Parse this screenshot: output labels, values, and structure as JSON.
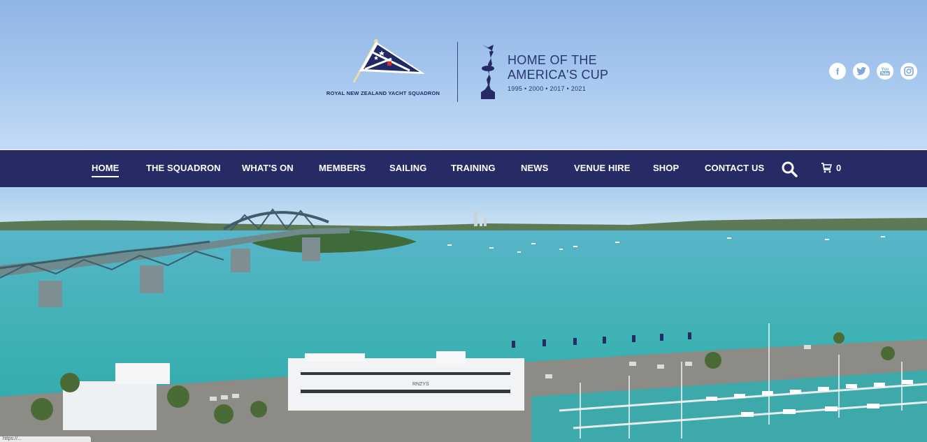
{
  "club": {
    "name": "ROYAL NEW ZEALAND YACHT SQUADRON",
    "tagline_line1": "HOME OF THE",
    "tagline_line2": "AMERICA'S CUP",
    "tagline_years": "1995 • 2000 • 2017 • 2021"
  },
  "social": [
    {
      "icon": "facebook-icon",
      "glyph": "f"
    },
    {
      "icon": "twitter-icon",
      "glyph": "🐦"
    },
    {
      "icon": "youtube-icon",
      "glyph": "You"
    },
    {
      "icon": "instagram-icon",
      "glyph": "◎"
    }
  ],
  "nav": {
    "items": [
      {
        "label": "HOME",
        "active": true
      },
      {
        "label": "THE SQUADRON",
        "active": false
      },
      {
        "label": "WHAT'S ON",
        "active": false
      },
      {
        "label": "MEMBERS",
        "active": false
      },
      {
        "label": "SAILING",
        "active": false
      },
      {
        "label": "TRAINING",
        "active": false
      },
      {
        "label": "NEWS",
        "active": false
      },
      {
        "label": "VENUE HIRE",
        "active": false
      },
      {
        "label": "SHOP",
        "active": false
      },
      {
        "label": "CONTACT US",
        "active": false
      }
    ],
    "cart_count": "0"
  },
  "hero": {
    "building_sign": "RNZYS"
  },
  "status": {
    "text": "https://..."
  },
  "colors": {
    "nav_bg": "#262b66",
    "brand_navy": "#1f2a66",
    "sea": "#3fb3b5"
  }
}
